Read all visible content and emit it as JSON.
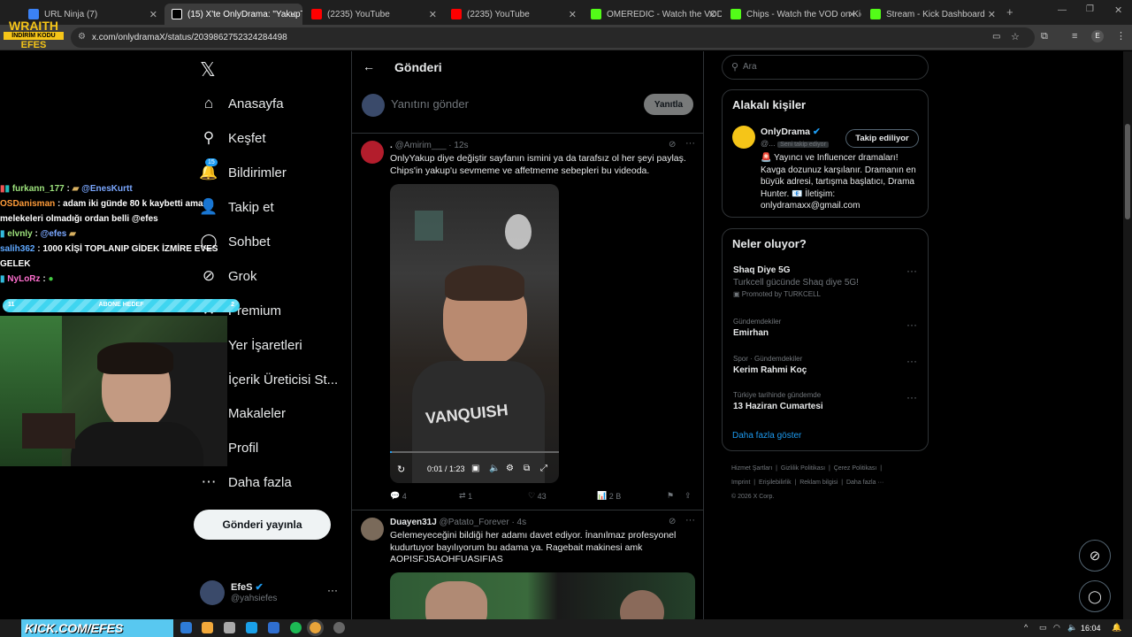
{
  "tabs": [
    {
      "title": "URL Ninja (7)",
      "color": "#3b82f6"
    },
    {
      "title": "(15) X'te OnlyDrama: \"YakupTV",
      "color": "#ffffff"
    },
    {
      "title": "(2235) YouTube",
      "color": "#ff0000"
    },
    {
      "title": "(2235) YouTube",
      "color": "#ff0000"
    },
    {
      "title": "OMEREDIC - Watch the VOD on",
      "color": "#53fc18"
    },
    {
      "title": "Chips - Watch the VOD on Kick",
      "color": "#53fc18"
    },
    {
      "title": "Stream - Kick Dashboard",
      "color": "#53fc18"
    }
  ],
  "url": "x.com/onlydramaX/status/2039862752324284498",
  "overlay_logo": {
    "top": "WRAITH",
    "middle": "İNDİRİM KODU",
    "bottom": "EFES"
  },
  "nav": {
    "items": [
      {
        "label": "Anasayfa",
        "icon": "home-icon",
        "glyph": "⌂"
      },
      {
        "label": "Keşfet",
        "icon": "search-icon",
        "glyph": "⚲"
      },
      {
        "label": "Bildirimler",
        "icon": "bell-icon",
        "glyph": "🔔"
      },
      {
        "label": "Takip et",
        "icon": "follow-icon",
        "glyph": "👤"
      },
      {
        "label": "Sohbet",
        "icon": "chat-icon",
        "glyph": "◯"
      },
      {
        "label": "Grok",
        "icon": "grok-icon",
        "glyph": "⊘"
      },
      {
        "label": "Premium",
        "icon": "premium-icon",
        "glyph": "✕"
      },
      {
        "label": "Yer İşaretleri",
        "icon": "bookmark-icon",
        "glyph": "⚑"
      },
      {
        "label": "İçerik Üreticisi St...",
        "icon": "studio-icon",
        "glyph": "▣"
      },
      {
        "label": "Makaleler",
        "icon": "articles-icon",
        "glyph": "▤"
      },
      {
        "label": "Profil",
        "icon": "profile-icon",
        "glyph": "👤"
      },
      {
        "label": "Daha fazla",
        "icon": "more-icon",
        "glyph": "⋯"
      }
    ],
    "notif_badge": "15",
    "post_button": "Gönderi yayınla",
    "account_name": "EfeS",
    "account_handle": "@yahsiefes"
  },
  "header": {
    "title": "Gönderi"
  },
  "composer": {
    "placeholder": "Yanıtını gönder",
    "button": "Yanıtla"
  },
  "tweet1": {
    "name": ".",
    "handle": "@Amirim___",
    "time": "· 12s",
    "text": "OnlyYakup diye değiştir sayfanın ismini ya da tarafsız ol her şeyi paylaş. Chips'in yakup'u sevmeme ve affetmeme sebepleri bu videoda.",
    "video_time": "0:01 / 1:23",
    "video_progress": 0.01,
    "replies": "4",
    "retweets": "1",
    "likes": "43",
    "views": "2 B"
  },
  "tweet2": {
    "name": "Duayen31J",
    "handle": "@Patato_Forever",
    "time": "· 4s",
    "text": "Gelemeyeceğini bildiği her adamı davet ediyor. İnanılmaz profesyonel kudurtuyor bayılıyorum bu adama ya. Ragebait makinesi amk AOPISFJSAOHFUASIFIAS"
  },
  "search": {
    "placeholder": "Ara"
  },
  "related": {
    "title": "Alakalı kişiler",
    "name": "OnlyDrama",
    "handle": "@...",
    "follows_you": "Seni takip ediyor",
    "follow_btn": "Takip ediliyor",
    "bio": "🚨 Yayıncı ve Influencer dramaları! Kavga dozunuz karşılanır. Dramanın en büyük adresi, tartışma başlatıcı, Drama Hunter. 📧 İletişim: onlydramaxx@gmail.com"
  },
  "trends": {
    "title": "Neler oluyor?",
    "items": [
      {
        "ctx": "",
        "name": "Shaq Diye 5G",
        "sub": "Turkcell gücünde Shaq diye 5G!",
        "promo": "Promoted by TURKCELL"
      },
      {
        "ctx": "Gündemdekiler",
        "name": "Emirhan"
      },
      {
        "ctx": "Spor · Gündemdekiler",
        "name": "Kerim Rahmi Koç"
      },
      {
        "ctx": "Türkiye tarihinde gündemde",
        "name": "13 Haziran Cumartesi"
      }
    ],
    "more": "Daha fazla göster"
  },
  "footer": {
    "links": [
      "Hizmet Şartları",
      "Gizlilik Politikası",
      "Çerez Politikası",
      "Imprint",
      "Erişilebilirlik",
      "Reklam bilgisi",
      "Daha fazla ···"
    ],
    "copy": "© 2026 X Corp."
  },
  "chat": [
    {
      "user": "furkann_177",
      "color": "#9ee37d",
      "msg": "@EnesKurtt"
    },
    {
      "user": "OSDanisman",
      "color": "#ff9c3a",
      "msg": "adam iki günde 80 k kaybetti ama melekeleri olmadığı ordan belli @efes"
    },
    {
      "user": "elvnly",
      "color": "#9ee37d",
      "msg": "@efes"
    },
    {
      "user": "salih362",
      "color": "#5fa8ff",
      "msg": "1000 KİŞİ TOPLANIP GİDEK İZMİRE EVES GELEK"
    },
    {
      "user": "NyLoRz",
      "color": "#ff6fcf",
      "msg": ""
    }
  ],
  "goal": {
    "label": "ABONE HEDEF",
    "left": "11",
    "right": "2"
  },
  "banner_text": "KICK.COM/EFES",
  "clock": "16:04"
}
